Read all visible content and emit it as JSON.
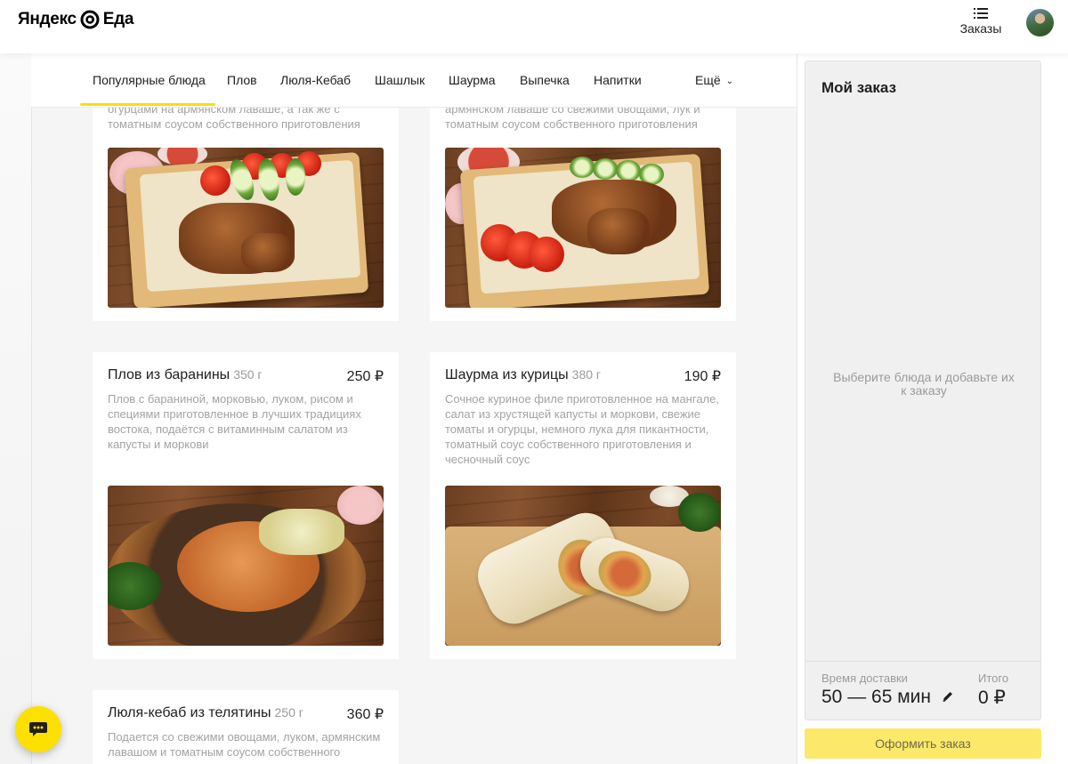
{
  "header": {
    "logo_text_1": "Яндекс",
    "logo_text_2": "Еда",
    "orders_label": "Заказы"
  },
  "tabs": [
    {
      "label": "Популярные блюда",
      "active": true
    },
    {
      "label": "Плов"
    },
    {
      "label": "Люля-Кебаб"
    },
    {
      "label": "Шашлык"
    },
    {
      "label": "Шаурма"
    },
    {
      "label": "Выпечка"
    },
    {
      "label": "Напитки"
    }
  ],
  "more_label": "Ещё",
  "cards_top_partial": [
    {
      "desc_line_1": "огурцами на армянском лаваше, а так же с",
      "desc_line_2": "томатным соусом собственного приготовления"
    },
    {
      "desc_line_1": "армянском лаваше со свежими овощами, лук и",
      "desc_line_2": "томатным соусом собственного приготовления"
    }
  ],
  "cards": [
    {
      "title": "Плов из баранины",
      "weight": "350 г",
      "price": "250 ₽",
      "desc": "Плов с бараниной, морковью, луком, рисом и специями приготовленное в лучших традициях востока, подаётся с витаминным салатом из капусты и моркови"
    },
    {
      "title": "Шаурма из курицы",
      "weight": "380 г",
      "price": "190 ₽",
      "desc": "Сочное куриное филе приготовленное на мангале, салат из хрустящей капусты и моркови, свежие томаты и огурцы, немного лука для пикантности, томатный соус собственного приготовления и чесночный соус"
    },
    {
      "title": "Люля-кебаб из телятины",
      "weight": "250 г",
      "price": "360 ₽",
      "desc": "Подается со свежими овощами, луком, армянским лавашом и томатным соусом собственного"
    }
  ],
  "order": {
    "title": "Мой заказ",
    "empty_text": "Выберите блюда и добавьте их к заказу",
    "delivery_label": "Время доставки",
    "delivery_value": "50 — 65 мин",
    "total_label": "Итого",
    "total_value": "0 ₽",
    "checkout_label": "Оформить заказ"
  },
  "colors": {
    "accent": "#fce000",
    "checkout_bg": "#fce96a",
    "muted_text": "#9b9b9b"
  },
  "icons": [
    "yandex-eda-logo-icon",
    "orders-list-icon",
    "avatar",
    "chevron-down-icon",
    "pencil-icon",
    "chat-icon"
  ]
}
